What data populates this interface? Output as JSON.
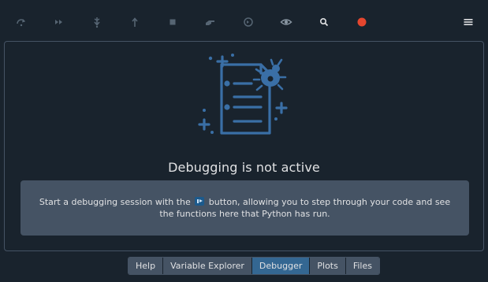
{
  "toolbar": {
    "buttons": [
      {
        "name": "step-over-icon"
      },
      {
        "name": "continue-icon"
      },
      {
        "name": "step-into-icon"
      },
      {
        "name": "step-return-icon"
      },
      {
        "name": "stop-icon"
      },
      {
        "name": "inspect-icon"
      },
      {
        "name": "goto-cursor-icon"
      },
      {
        "name": "watch-icon"
      },
      {
        "name": "search-icon"
      },
      {
        "name": "breakpoint-icon",
        "color": "#e5462e"
      }
    ],
    "menu": {
      "name": "hamburger-menu-icon"
    }
  },
  "debugger": {
    "title": "Debugging is not active",
    "message_before": "Start a debugging session with the",
    "message_after": "button, allowing you to step through your code and see the functions here that Python has run."
  },
  "tabs": [
    {
      "label": "Help",
      "active": false
    },
    {
      "label": "Variable Explorer",
      "active": false
    },
    {
      "label": "Debugger",
      "active": true
    },
    {
      "label": "Plots",
      "active": false
    },
    {
      "label": "Files",
      "active": false
    }
  ],
  "colors": {
    "background": "#19232d",
    "panel": "#455364",
    "accent": "#346792",
    "icon": "#3a6fa6"
  }
}
